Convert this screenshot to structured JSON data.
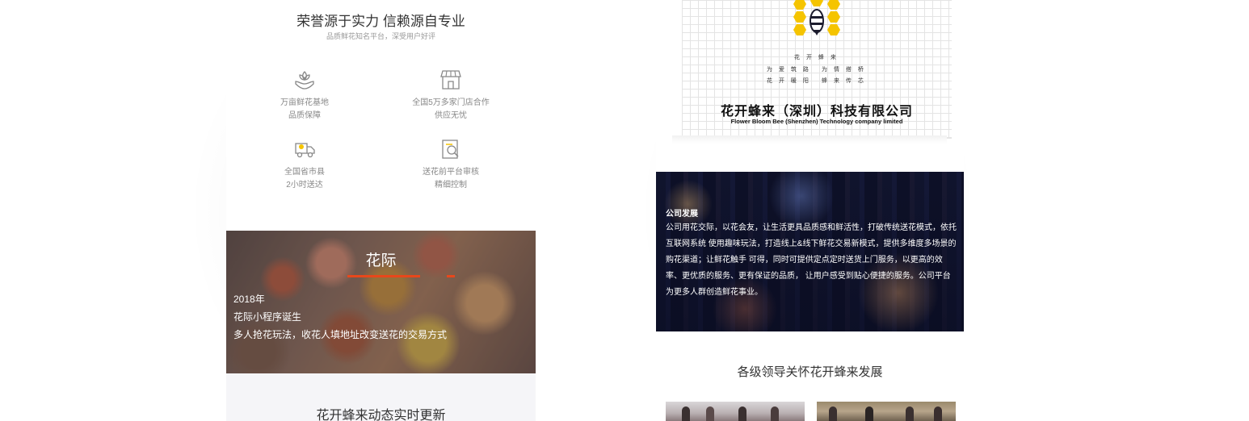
{
  "honor": {
    "title": "荣誉源于实力 信赖源自专业",
    "subtitle": "品质鲜花知名平台，深受用户好评",
    "features": [
      {
        "icon": "flower-hand-icon",
        "line1": "万亩鲜花基地",
        "line2": "品质保障"
      },
      {
        "icon": "storefront-icon",
        "line1": "全国5万多家门店合作",
        "line2": "供应无忧"
      },
      {
        "icon": "delivery-truck-icon",
        "line1": "全国省市县",
        "line2": "2小时送达"
      },
      {
        "icon": "document-search-icon",
        "line1": "送花前平台审核",
        "line2": "精细控制"
      }
    ]
  },
  "huaji": {
    "title": "花际",
    "year": "2018年",
    "headline": "花际小程序诞生",
    "desc": "多人抢花玩法，收花人填地址改变送花的交易方式"
  },
  "dynamic": {
    "title": "花开蜂来动态实时更新"
  },
  "logo": {
    "slogans": [
      "花 开 蜂 来",
      "为 爱 筑 路",
      "为 情 搭 桥",
      "花 开 暖 阳",
      "蜂 来 传 芯"
    ],
    "company_cn": "花开蜂来（深圳）科技有限公司",
    "company_en": "Flower Bloom Bee (Shenzhen) Technology company limited",
    "colors": {
      "honeycomb": "#f5c400",
      "bee_dark": "#1c1c2e"
    }
  },
  "develop": {
    "title": "公司发展",
    "text": "公司用花交际，以花会友，让生活更具品质感和鲜活性，打破传统送花模式，依托互联网系统 使用趣味玩法，打造线上&线下鲜花交易新模式，提供多维度多场景的购花渠道；让鲜花触手 可得，同时可提供定点定时送货上门服务，以更高的效率、更优质的服务、更有保证的品质， 让用户感受到贴心便捷的服务。公司平台为更多人群创造鲜花事业。"
  },
  "leaders": {
    "title": "各级领导关怀花开蜂来发展"
  },
  "colors": {
    "accent": "#e8471b"
  }
}
